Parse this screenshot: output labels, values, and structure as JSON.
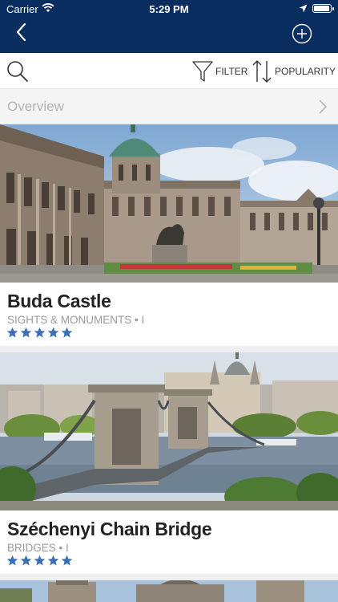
{
  "status_bar": {
    "carrier": "Carrier",
    "time": "5:29 PM"
  },
  "toolbar": {
    "filter_label": "FILTER",
    "sort_label": "POPULARITY"
  },
  "overview": {
    "label": "Overview"
  },
  "items": [
    {
      "title": "Buda Castle",
      "category": "SIGHTS & MONUMENTS • I",
      "rating": 5
    },
    {
      "title": "Széchenyi Chain Bridge",
      "category": "BRIDGES • I",
      "rating": 5
    }
  ],
  "colors": {
    "nav_bg": "#0a2d5f",
    "star": "#3b6eb5"
  }
}
